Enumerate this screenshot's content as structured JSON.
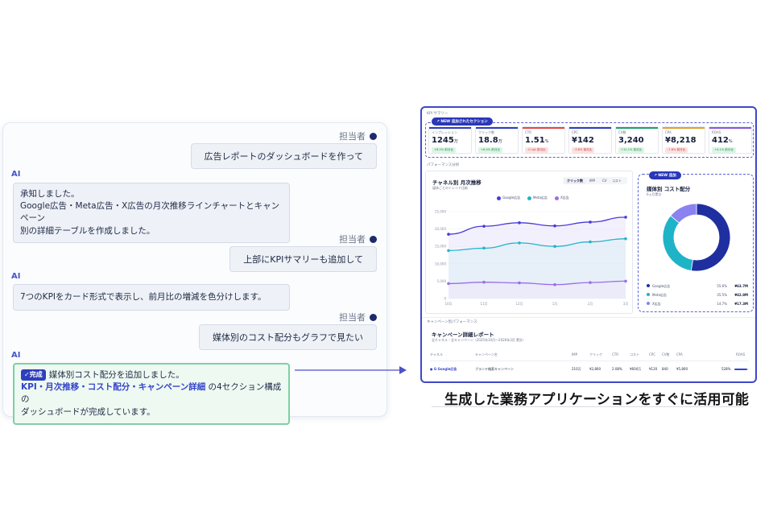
{
  "chat": {
    "messages": [
      {
        "role": "user",
        "name": "担当者",
        "text": "広告レポートのダッシュボードを作って"
      },
      {
        "role": "ai",
        "name": "AI",
        "lines": [
          "承知しました。",
          "Google広告・Meta広告・X広告の月次推移ラインチャートとキャンペーン",
          "別の詳細テーブルを作成しました。"
        ]
      },
      {
        "role": "user",
        "name": "担当者",
        "text": "上部にKPIサマリーも追加して"
      },
      {
        "role": "ai",
        "name": "AI",
        "lines": [
          "7つのKPIをカード形式で表示し、前月比の増減を色分けします。"
        ]
      },
      {
        "role": "user",
        "name": "担当者",
        "text": "媒体別のコスト配分もグラフで見たい"
      },
      {
        "role": "ai",
        "name": "AI",
        "badge": "✓完成",
        "line1": "媒体別コスト配分を追加しました。",
        "highlight": "KPI・月次推移・コスト配分・キャンペーン詳細",
        "line2_rest": " の4セクション構成の",
        "line3": "ダッシュボードが完成しています。"
      }
    ]
  },
  "dashboard": {
    "kpi_section_label": "KPI サマリー",
    "kpi_new_tag": "↗ NEW 追加されたセクション",
    "kpis": [
      {
        "label": "インプレッション",
        "value": "1245",
        "unit": "万",
        "change": "+8.2% 前月比",
        "dir": "up",
        "color": "#2f3dbd"
      },
      {
        "label": "クリック数",
        "value": "18.8",
        "unit": "万",
        "change": "+6.4% 前月比",
        "dir": "up",
        "color": "#2f3dbd"
      },
      {
        "label": "CTR",
        "value": "1.51",
        "unit": "%",
        "change": "-0.1pt 前月比",
        "dir": "dn",
        "color": "#e04848"
      },
      {
        "label": "CPC",
        "value": "¥142",
        "unit": "",
        "change": "-3.8% 前月比",
        "dir": "dn",
        "color": "#2f3dbd"
      },
      {
        "label": "CV数",
        "value": "3,240",
        "unit": "",
        "change": "+12.1% 前月比",
        "dir": "up",
        "color": "#1f9f6a"
      },
      {
        "label": "CPA",
        "value": "¥8,218",
        "unit": "",
        "change": "-7.8% 前月比",
        "dir": "dn",
        "color": "#e0a030"
      },
      {
        "label": "ROAS",
        "value": "412",
        "unit": "%",
        "change": "+4.1% 前月比",
        "dir": "up",
        "color": "#8a56d8"
      }
    ],
    "perf_section_label": "パフォーマンス分析",
    "trend": {
      "title": "チャネル別 月次推移",
      "subtitle": "媒体ごとのトレンド比較",
      "toggles": [
        "クリック数",
        "IMP",
        "CV",
        "コスト"
      ]
    },
    "donut_new_tag": "↗ NEW 追加",
    "donut": {
      "title": "媒体別 コスト配分",
      "subtitle": "6ヵ月累計",
      "rows": [
        {
          "name": "Google広告",
          "pct": "55.6%",
          "amount": "¥63.7M",
          "color": "#1f2fa0"
        },
        {
          "name": "Meta広告",
          "pct": "35.5%",
          "amount": "¥42.8M",
          "color": "#1fb3c8"
        },
        {
          "name": "X広告",
          "pct": "14.7%",
          "amount": "¥17.3M",
          "color": "#8a82f0"
        }
      ]
    },
    "table": {
      "section_label": "キャンペーン別パフォーマンス",
      "title": "キャンペーン詳細レポート",
      "subtitle": "全チャネル・全キャンペーン（2025年10月〜2026年3月 累計）",
      "headers": [
        "チャネル",
        "キャンペーン名",
        "IMP",
        "クリック",
        "CTR",
        "コスト",
        "CPC",
        "CV数",
        "CPA",
        "ROAS"
      ],
      "row": [
        "● G Google広告",
        "ブランド検索キャンペーン",
        "210万",
        "¥2,800",
        "2.08%",
        "¥604万",
        "¥120",
        "840",
        "¥5,800",
        "528%"
      ]
    }
  },
  "chart_data": {
    "type": "line",
    "title": "チャネル別 月次推移",
    "x": [
      "10月",
      "11月",
      "12月",
      "1月",
      "2月",
      "3月"
    ],
    "y_ticks": [
      "25,000",
      "20,000",
      "15,000",
      "10,000",
      "5,000",
      "0"
    ],
    "ylim": [
      0,
      25000
    ],
    "series": [
      {
        "name": "Google広告",
        "color": "#4a3ad8",
        "values": [
          18500,
          20800,
          21800,
          20900,
          22000,
          23400
        ]
      },
      {
        "name": "Meta広告",
        "color": "#23b5c9",
        "values": [
          13800,
          14500,
          16000,
          15000,
          16300,
          17200
        ]
      },
      {
        "name": "X広告",
        "color": "#9a6ee6",
        "values": [
          4300,
          4700,
          4500,
          4000,
          4600,
          5000
        ]
      }
    ],
    "legend": "top-center",
    "grid": true
  },
  "donut_data": {
    "type": "pie",
    "categories": [
      "Google広告",
      "Meta広告",
      "X広告"
    ],
    "values": [
      55.6,
      35.5,
      14.7
    ],
    "colors": [
      "#1f2fa0",
      "#1fb3c8",
      "#8a82f0"
    ]
  },
  "caption": "生成した業務アプリケーションをすぐに活用可能"
}
